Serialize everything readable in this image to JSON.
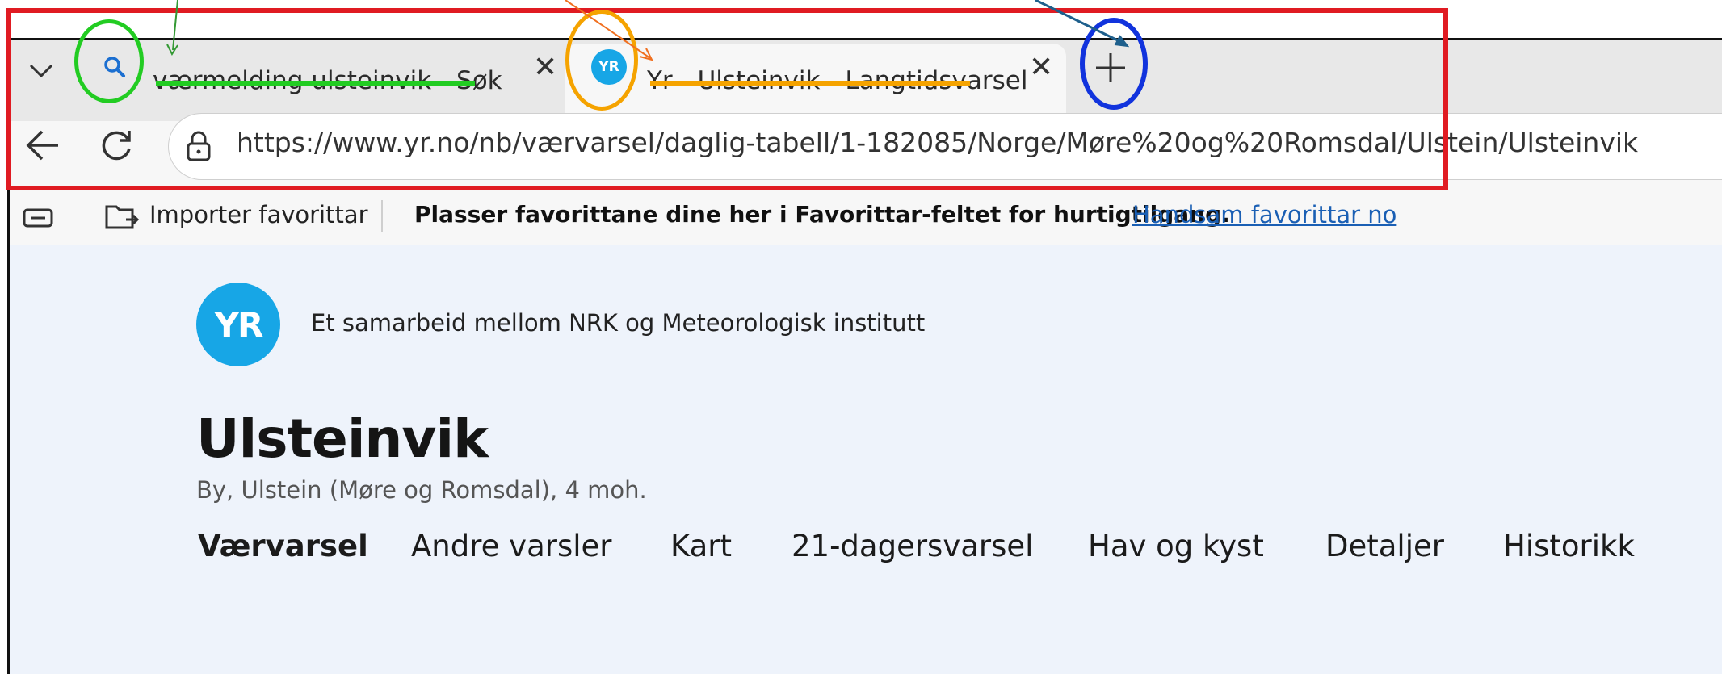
{
  "browser": {
    "tabs": [
      {
        "title": "værmelding ulsteinvik - Søk",
        "icon": "search-icon",
        "active": false
      },
      {
        "title": "Yr - Ulsteinvik - Langtidsvarsel",
        "icon": "yr-favicon",
        "active": true
      }
    ],
    "new_tab_icon": "plus-icon",
    "tab_list_icon": "chevron-down-icon",
    "back_icon": "back-arrow-icon",
    "refresh_icon": "refresh-icon",
    "lock_icon": "lock-icon",
    "url": "https://www.yr.no/nb/værvarsel/daglig-tabell/1-182085/Norge/Møre%20og%20Romsdal/Ulstein/Ulsteinvik"
  },
  "favorites_bar": {
    "import_label": "Importer favorittar",
    "hint": "Plasser favorittane dine her i Favorittar-feltet for hurtigtilgang.",
    "manage_link": "Handsam favorittar no"
  },
  "page": {
    "logo_text": "YR",
    "tagline": "Et samarbeid mellom NRK og Meteorologisk institutt",
    "title": "Ulsteinvik",
    "subtitle": "By, Ulstein (Møre og Romsdal), 4 moh.",
    "nav": [
      "Værvarsel",
      "Andre varsler",
      "Kart",
      "21-dagersvarsel",
      "Hav og kyst",
      "Detaljer",
      "Historikk"
    ]
  },
  "annotations": {
    "red": "#e01b22",
    "green": "#22cc22",
    "orange": "#f5a300",
    "blue": "#1133dd"
  }
}
